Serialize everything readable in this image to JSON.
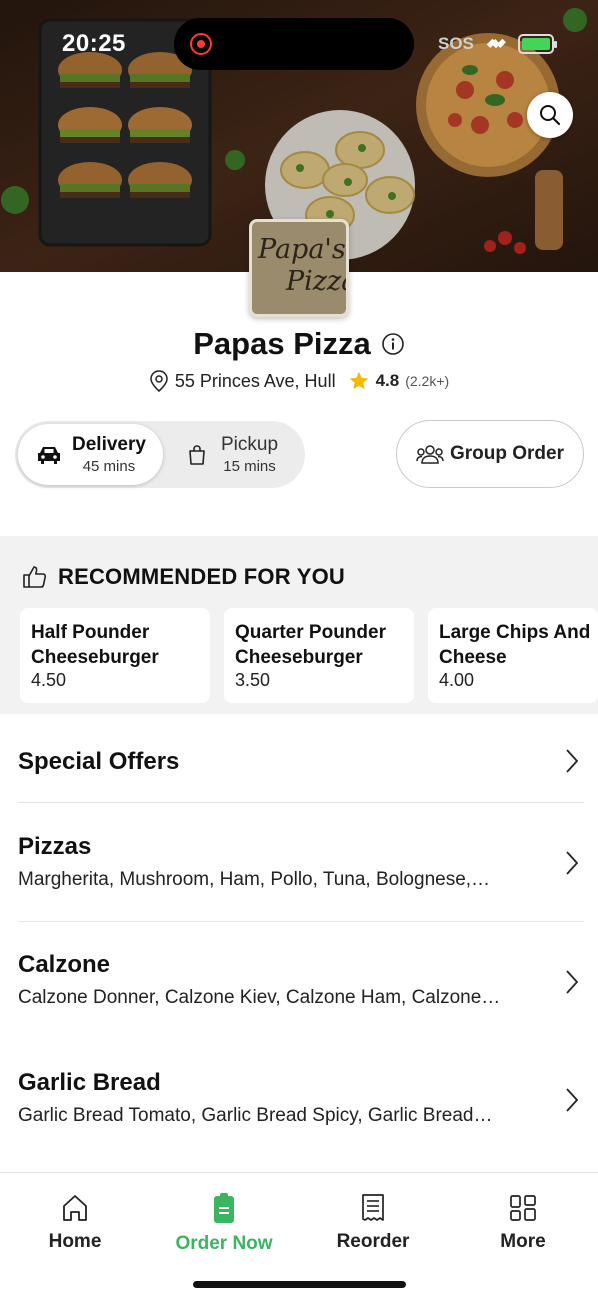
{
  "status_bar": {
    "time": "20:25",
    "carrier": "SOS"
  },
  "store": {
    "name": "Papas Pizza",
    "logo_line1": "Papa's",
    "logo_line2": "Pizza",
    "address": "55 Princes Ave, Hull",
    "rating": "4.8",
    "rating_count": "(2.2k+)"
  },
  "order_modes": {
    "delivery": {
      "label": "Delivery",
      "time": "45 mins"
    },
    "pickup": {
      "label": "Pickup",
      "time": "15 mins"
    },
    "selected": "delivery"
  },
  "group_order_label": "Group Order",
  "recommended": {
    "title": "RECOMMENDED FOR YOU",
    "items": [
      {
        "name_line1": "Half Pounder",
        "name_line2": "Cheeseburger",
        "price": "4.50"
      },
      {
        "name_line1": "Quarter Pounder",
        "name_line2": "Cheeseburger",
        "price": "3.50"
      },
      {
        "name_line1": "Large Chips And",
        "name_line2": "Cheese",
        "price": "4.00"
      }
    ]
  },
  "menu": [
    {
      "title": "Special Offers",
      "description": ""
    },
    {
      "title": "Pizzas",
      "description": "Margherita, Mushroom, Ham, Pollo, Tuna, Bolognese,…"
    },
    {
      "title": "Calzone",
      "description": "Calzone Donner, Calzone Kiev, Calzone Ham, Calzone…"
    },
    {
      "title": "Garlic Bread",
      "description": "Garlic Bread Tomato, Garlic Bread Spicy, Garlic Bread…"
    }
  ],
  "bottom_nav": {
    "items": [
      {
        "label": "Home",
        "icon": "home-icon"
      },
      {
        "label": "Order Now",
        "icon": "order-icon"
      },
      {
        "label": "Reorder",
        "icon": "receipt-icon"
      },
      {
        "label": "More",
        "icon": "grid-icon"
      }
    ],
    "active_color": "#3cb563"
  },
  "colors": {
    "accent": "#3cb563",
    "star": "#f5b800"
  }
}
